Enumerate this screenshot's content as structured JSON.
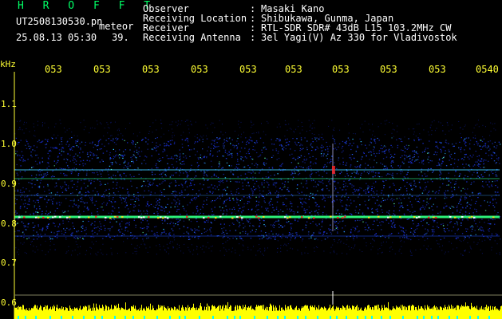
{
  "header": {
    "app_name": "H R O F F T",
    "filename": "UT2508130530.pn",
    "mode": "meteor",
    "timestamp": "25.08.13 05:30",
    "count": "39.",
    "fields": [
      {
        "label": "Observer",
        "value": "Masaki Kano"
      },
      {
        "label": "Receiving Location",
        "value": "Shibukawa, Gunma, Japan"
      },
      {
        "label": "Receiver",
        "value": "RTL-SDR SDR# 43dB L15 103.2MHz CW"
      },
      {
        "label": "Receiving Antenna",
        "value": "3el Yagi(V) Az 330 for Vladivostok"
      }
    ],
    "separator": ":"
  },
  "axis": {
    "unit_label": "kHz",
    "time_ticks": [
      "053",
      "053",
      "053",
      "053",
      "053",
      "053",
      "053",
      "053",
      "053",
      "0540"
    ],
    "freq_ticks": [
      "1.1",
      "1.0",
      "0.9",
      "0.8",
      "0.7",
      "0.6"
    ]
  },
  "colors": {
    "axis": "#ffff33",
    "background": "#000000",
    "signal_core": "#ff2020",
    "noise_blue": "#2040ff",
    "amplitude_bars": "#ffff00",
    "amplitude_base": "#00ffff"
  }
}
